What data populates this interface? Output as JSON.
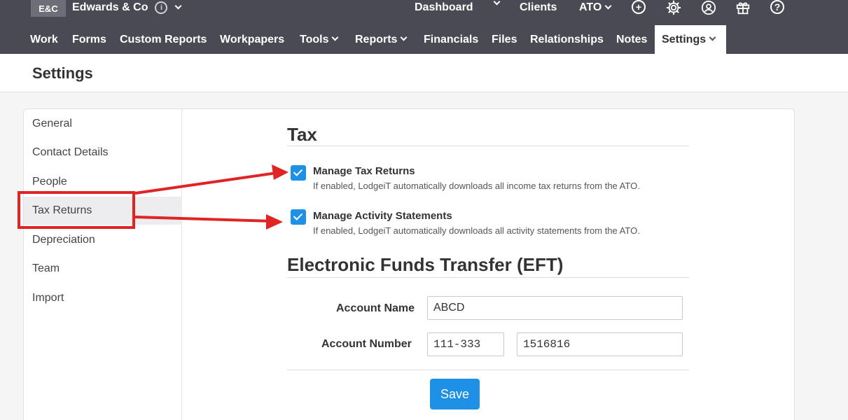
{
  "topbar": {
    "badge": "E&C",
    "firm_name": "Edwards & Co",
    "info_glyph": "i",
    "items": [
      "Dashboard",
      "Clients",
      "ATO"
    ]
  },
  "main_nav": {
    "items": [
      {
        "label": "Work"
      },
      {
        "label": "Forms"
      },
      {
        "label": "Custom Reports"
      },
      {
        "label": "Workpapers"
      },
      {
        "label": "Tools"
      },
      {
        "label": "Reports"
      },
      {
        "label": "Financials"
      },
      {
        "label": "Files"
      },
      {
        "label": "Relationships"
      },
      {
        "label": "Notes"
      },
      {
        "label": "Settings"
      }
    ],
    "active": "Settings"
  },
  "page": {
    "title": "Settings"
  },
  "sidebar": {
    "items": [
      "General",
      "Contact Details",
      "People",
      "Tax Returns",
      "Depreciation",
      "Team",
      "Import"
    ],
    "active": "Tax Returns"
  },
  "tax": {
    "title": "Tax",
    "manage_tax_returns": {
      "label": "Manage Tax Returns",
      "help": "If enabled, LodgeiT automatically downloads all income tax returns from the ATO.",
      "checked": true
    },
    "manage_activity_statements": {
      "label": "Manage Activity Statements",
      "help": "If enabled, LodgeiT automatically downloads all activity statements from the ATO.",
      "checked": true
    }
  },
  "eft": {
    "title": "Electronic Funds Transfer (EFT)",
    "account_name_label": "Account Name",
    "account_name": "ABCD",
    "account_number_label": "Account Number",
    "bsb": "111-333",
    "account_number": "1516816",
    "save_label": "Save"
  },
  "colors": {
    "topbar": "#4a4a54",
    "accent": "#1e90e6",
    "annotation": "#e02424"
  },
  "icons": [
    "info-icon",
    "chevron-down-icon",
    "add-circle-icon",
    "gear-icon",
    "user-circle-icon",
    "gift-icon",
    "help-icon"
  ]
}
